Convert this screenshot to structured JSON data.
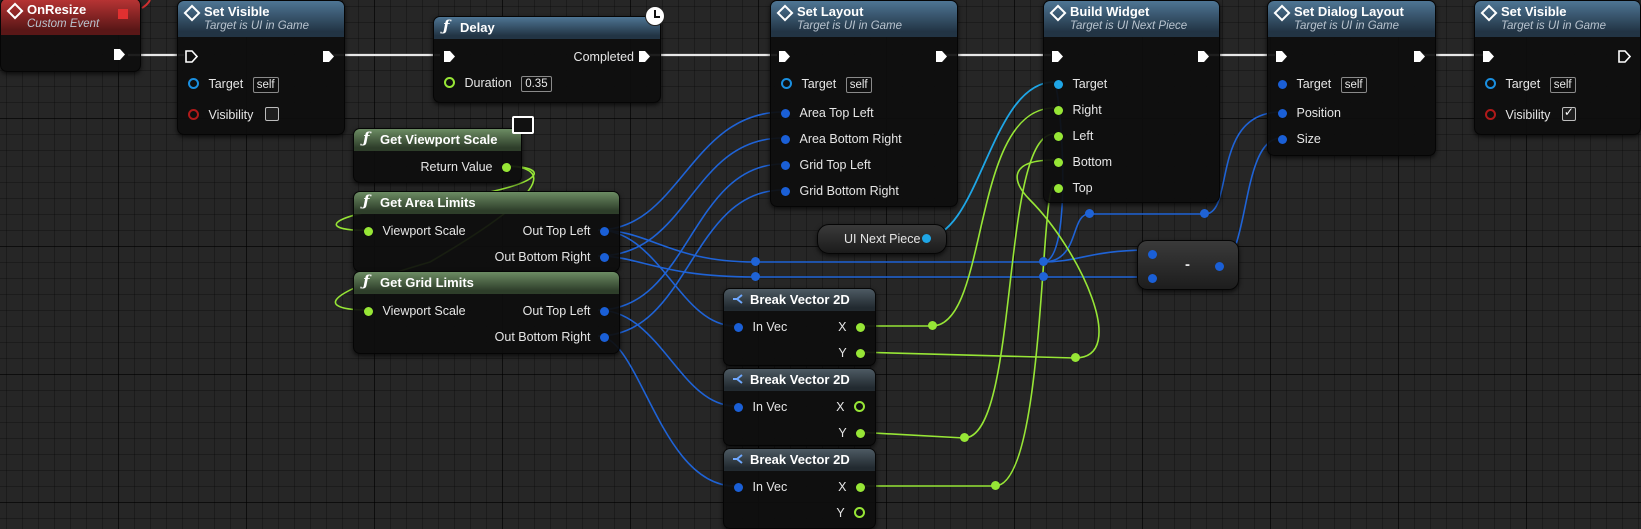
{
  "nodes": {
    "on_resize": {
      "title": "OnResize",
      "subtitle": "Custom Event"
    },
    "set_visible_1": {
      "title": "Set Visible",
      "subtitle": "Target is UI in Game",
      "target_label": "Target",
      "target_value": "self",
      "visibility_label": "Visibility",
      "visibility_checked": false
    },
    "delay": {
      "title": "Delay",
      "completed_label": "Completed",
      "duration_label": "Duration",
      "duration_value": "0.35"
    },
    "get_viewport_scale": {
      "title": "Get Viewport Scale",
      "return_label": "Return Value"
    },
    "get_area_limits": {
      "title": "Get Area Limits",
      "in_label": "Viewport Scale",
      "out1": "Out Top Left",
      "out2": "Out Bottom Right"
    },
    "get_grid_limits": {
      "title": "Get Grid Limits",
      "in_label": "Viewport Scale",
      "out1": "Out Top Left",
      "out2": "Out Bottom Right"
    },
    "set_layout": {
      "title": "Set Layout",
      "subtitle": "Target is UI in Game",
      "target_label": "Target",
      "target_value": "self",
      "pins": [
        "Area Top Left",
        "Area Bottom Right",
        "Grid Top Left",
        "Grid Bottom Right"
      ]
    },
    "ui_next_piece": {
      "label": "UI Next Piece"
    },
    "break_vector_1": {
      "title": "Break Vector 2D",
      "in_label": "In Vec",
      "x_label": "X",
      "y_label": "Y"
    },
    "break_vector_2": {
      "title": "Break Vector 2D",
      "in_label": "In Vec",
      "x_label": "X",
      "y_label": "Y"
    },
    "break_vector_3": {
      "title": "Break Vector 2D",
      "in_label": "In Vec",
      "x_label": "X",
      "y_label": "Y"
    },
    "build_widget": {
      "title": "Build Widget",
      "subtitle": "Target is UI Next Piece",
      "pins": [
        "Target",
        "Right",
        "Left",
        "Bottom",
        "Top"
      ]
    },
    "minus": {
      "label": "-"
    },
    "set_dialog_layout": {
      "title": "Set Dialog Layout",
      "subtitle": "Target is UI in Game",
      "target_label": "Target",
      "target_value": "self",
      "pins": [
        "Position",
        "Size"
      ]
    },
    "set_visible_2": {
      "title": "Set Visible",
      "subtitle": "Target is UI in Game",
      "target_label": "Target",
      "target_value": "self",
      "visibility_label": "Visibility",
      "visibility_checked": true
    }
  },
  "colors": {
    "exec": "#ffffff",
    "vector2d": "#1a5fd6",
    "float": "#97e636",
    "object": "#1fa6e6",
    "bool": "#b01a1a"
  }
}
